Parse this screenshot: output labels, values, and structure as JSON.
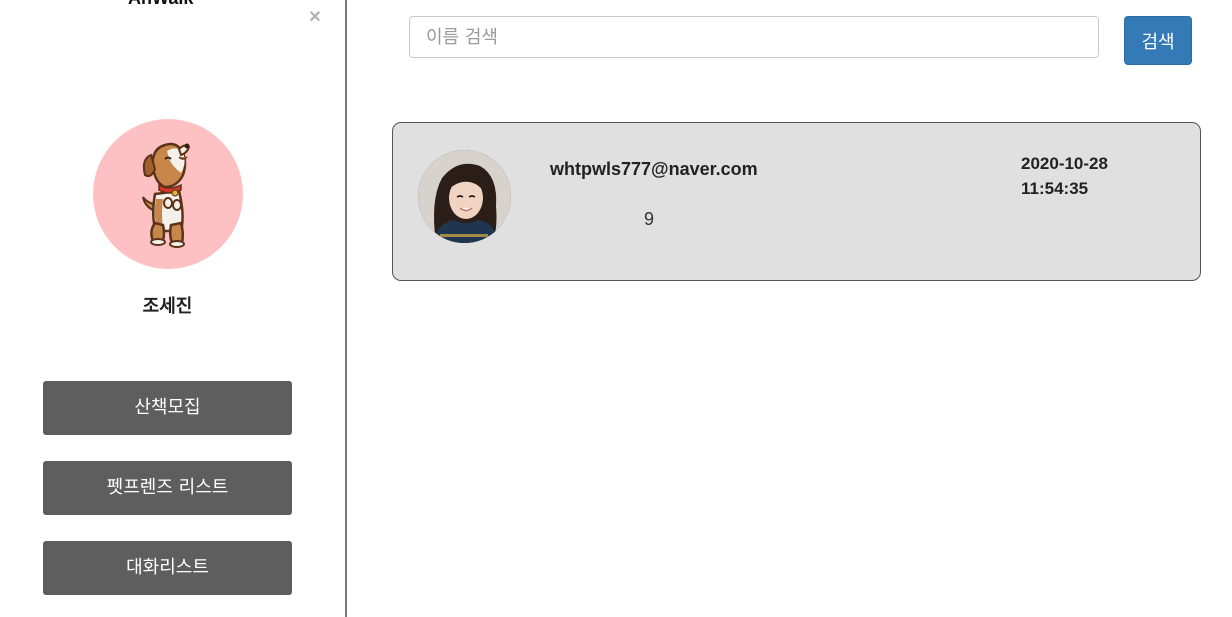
{
  "sidebar": {
    "brand": "AnWalk",
    "close_label": "×",
    "profile": {
      "name": "조세진",
      "avatar_icon": "dog-icon",
      "avatar_bg": "#fdc1c4"
    },
    "menu": [
      {
        "label": "산책모집"
      },
      {
        "label": "펫프렌즈 리스트"
      },
      {
        "label": "대화리스트"
      }
    ]
  },
  "search": {
    "placeholder": "이름 검색",
    "value": "",
    "button_label": "검색",
    "button_color": "#337ab7"
  },
  "friends": [
    {
      "email": "whtpwls777@naver.com",
      "count": "9",
      "date": "2020-10-28",
      "time": "11:54:35"
    }
  ]
}
